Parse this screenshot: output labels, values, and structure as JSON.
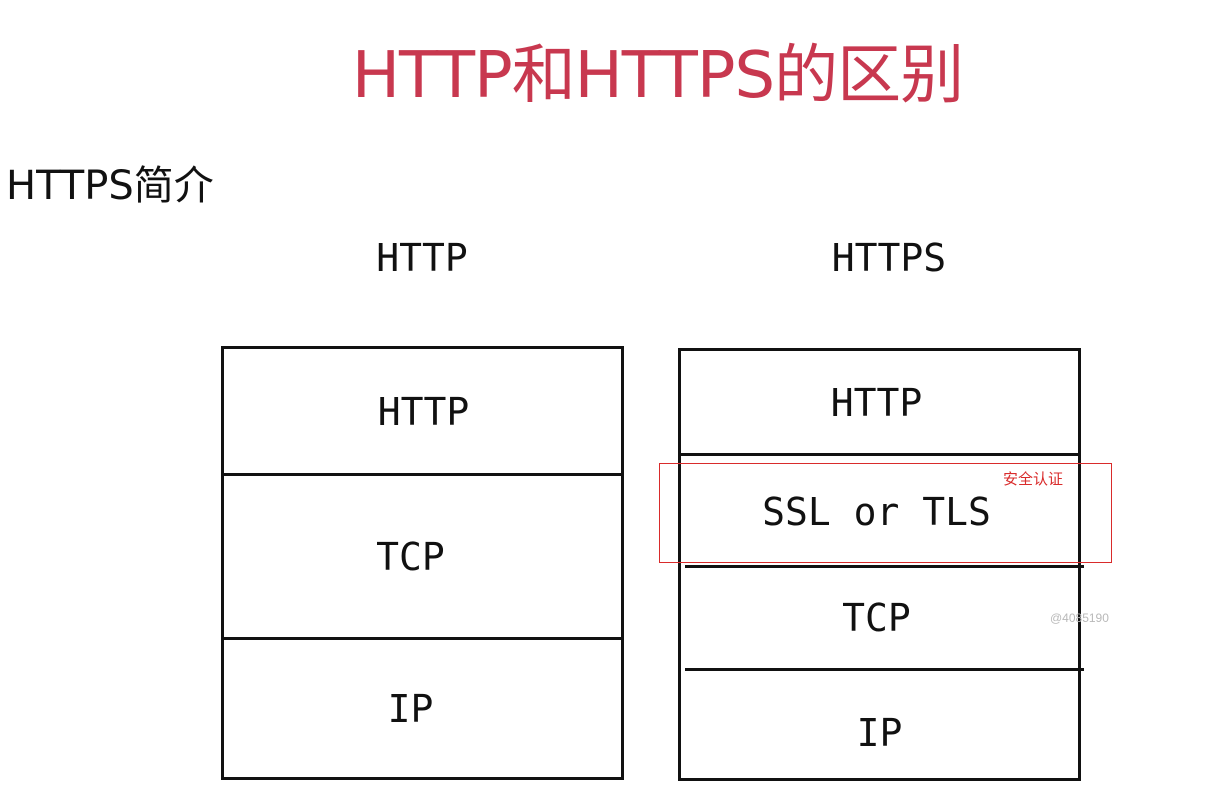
{
  "title": "HTTP和HTTPS的区别",
  "section_title": "HTTPS简介",
  "diagram": {
    "left_column": {
      "label": "HTTP",
      "layers": [
        "HTTP",
        "TCP",
        "IP"
      ]
    },
    "right_column": {
      "label": "HTTPS",
      "layers": [
        "HTTP",
        "SSL or TLS",
        "TCP",
        "IP"
      ]
    },
    "highlight": {
      "note": "安全认证",
      "color": "#d92b2b"
    }
  },
  "watermark": "@4085190",
  "colors": {
    "title": "#c8384f",
    "text": "#111111",
    "highlight": "#d92b2b"
  }
}
